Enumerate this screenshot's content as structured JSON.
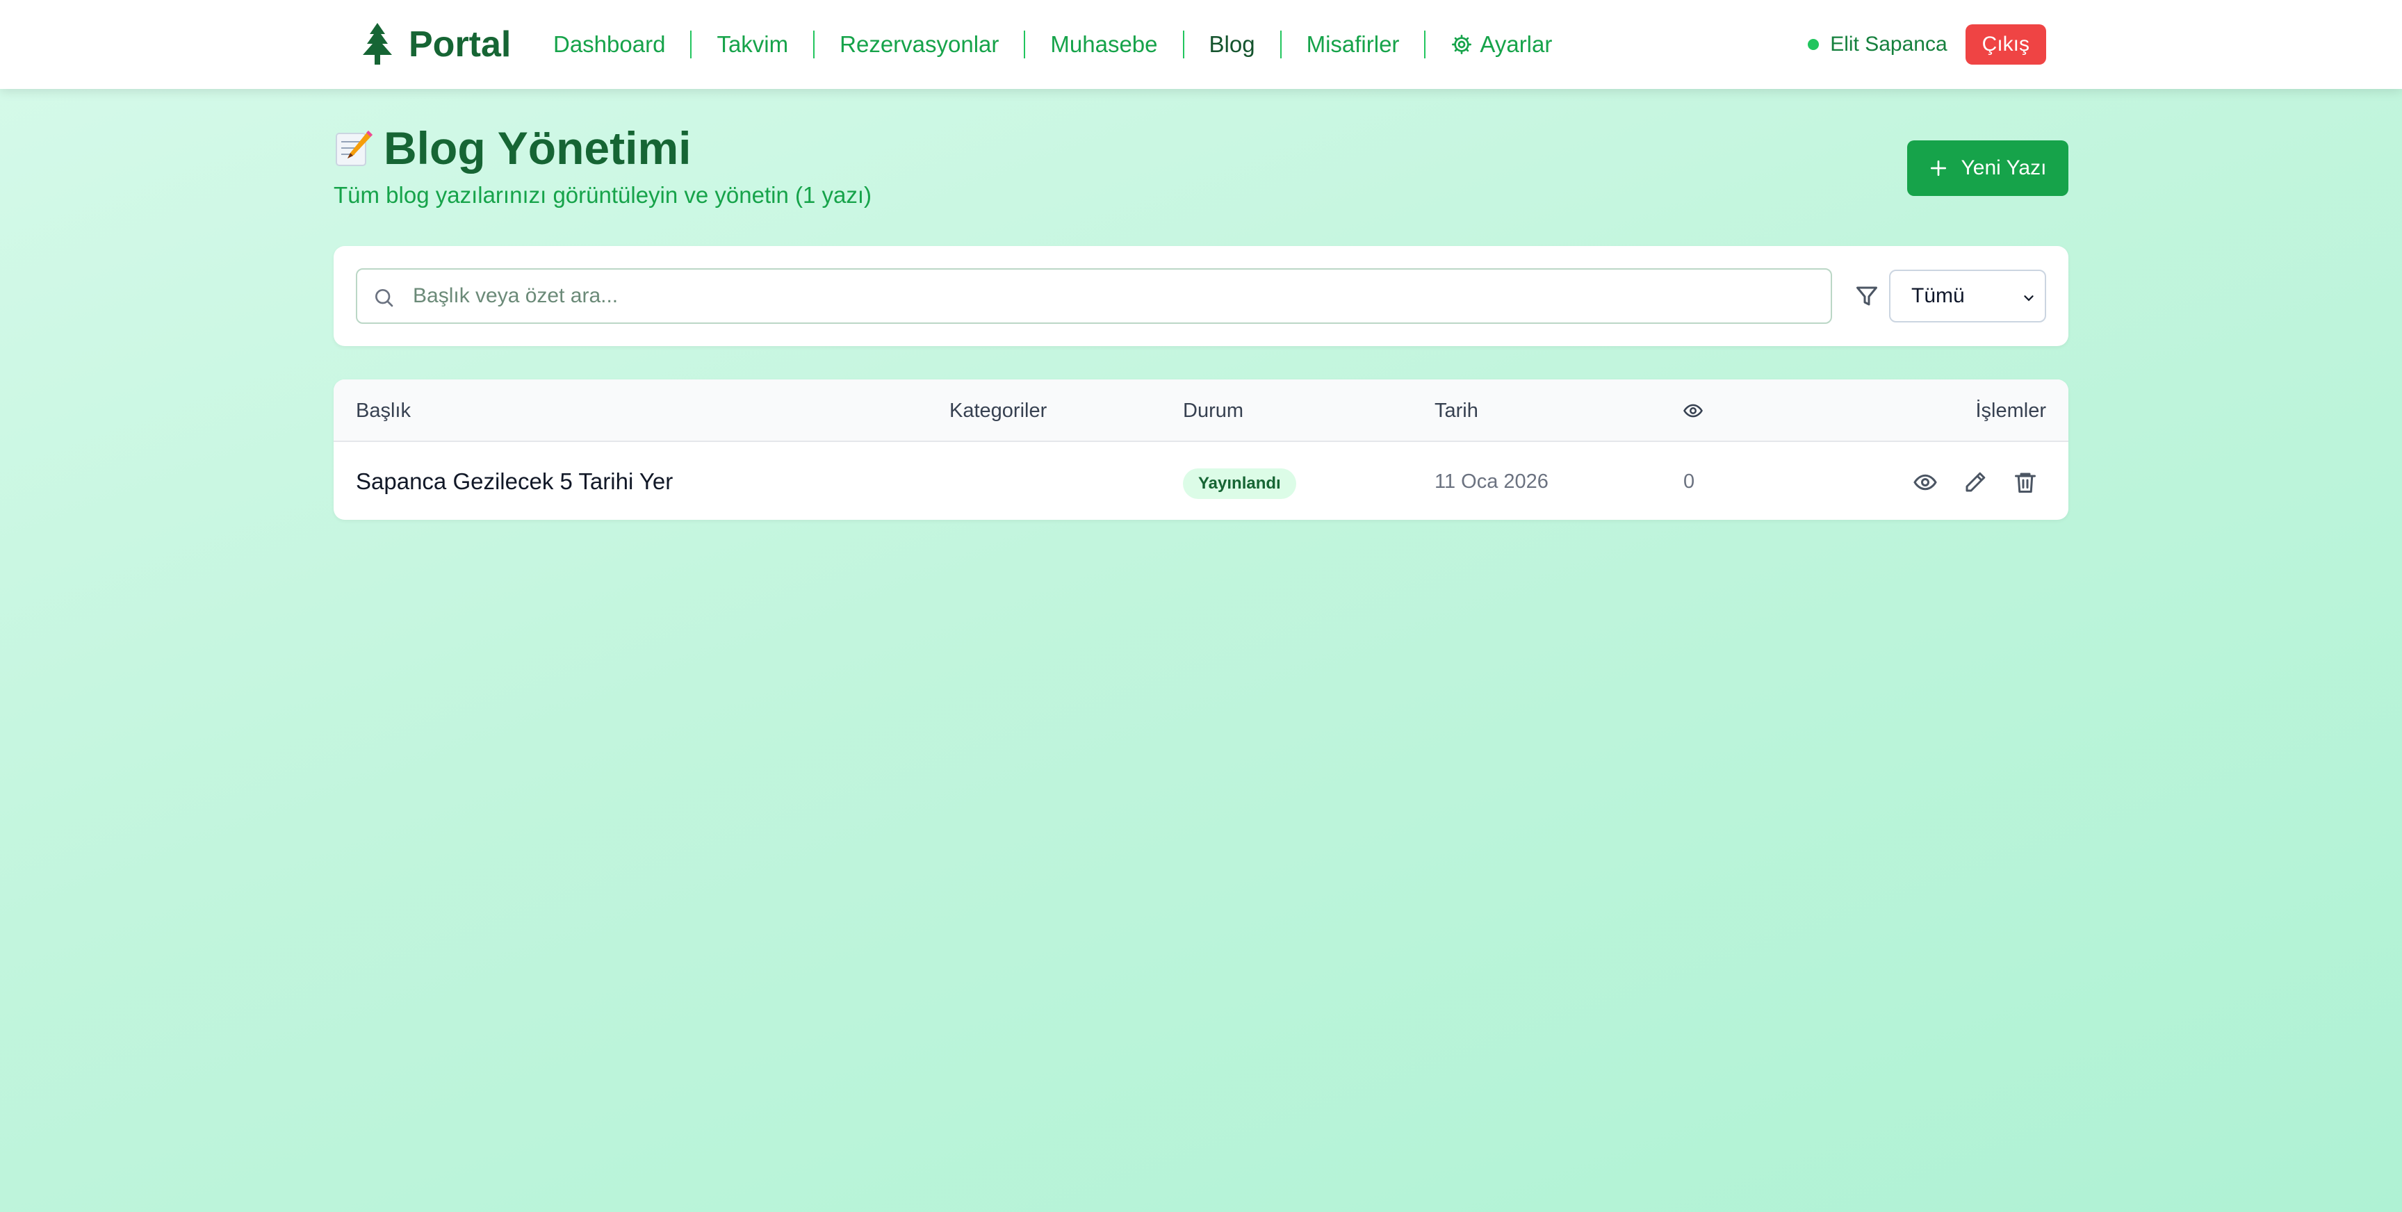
{
  "brand": {
    "name": "Portal",
    "icon": "tree-icon"
  },
  "nav": {
    "items": [
      {
        "label": "Dashboard",
        "active": false
      },
      {
        "label": "Takvim",
        "active": false
      },
      {
        "label": "Rezervasyonlar",
        "active": false
      },
      {
        "label": "Muhasebe",
        "active": false
      },
      {
        "label": "Blog",
        "active": true
      },
      {
        "label": "Misafirler",
        "active": false
      },
      {
        "label": "Ayarlar",
        "active": false,
        "icon": "gear-icon"
      }
    ]
  },
  "user": {
    "name": "Elit Sapanca",
    "status_color": "#22c55e",
    "logout_label": "Çıkış"
  },
  "page": {
    "title": "Blog Yönetimi",
    "title_icon": "memo-icon",
    "subtitle": "Tüm blog yazılarınızı görüntüleyin ve yönetin (1 yazı)",
    "new_post_label": "Yeni Yazı"
  },
  "filters": {
    "search_placeholder": "Başlık veya özet ara...",
    "search_value": "",
    "status_selected": "Tümü"
  },
  "table": {
    "headers": {
      "title": "Başlık",
      "categories": "Kategoriler",
      "status": "Durum",
      "date": "Tarih",
      "views_icon": "eye-icon",
      "actions": "İşlemler"
    },
    "rows": [
      {
        "title": "Sapanca Gezilecek 5 Tarihi Yer",
        "categories": "",
        "status": "Yayınlandı",
        "date": "11 Oca 2026",
        "views": "0"
      }
    ]
  },
  "colors": {
    "brand_green": "#166534",
    "accent_green": "#16a34a",
    "danger_red": "#ef4444",
    "badge_bg": "#dcfce7"
  }
}
